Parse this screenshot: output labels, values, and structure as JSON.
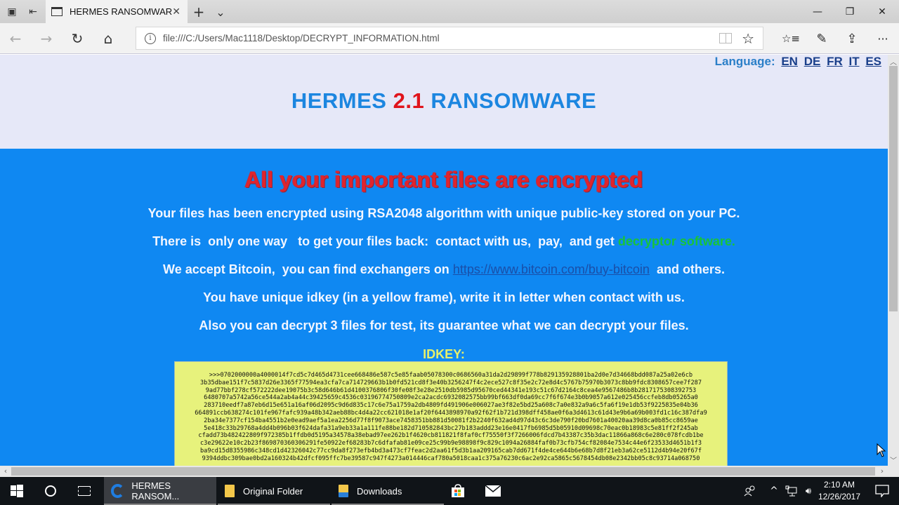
{
  "browser": {
    "tab_title": "HERMES RANSOMWAR",
    "address_url": "file:///C:/Users/Mac1118/Desktop/DECRYPT_INFORMATION.html",
    "icons": {
      "tab_preview": "▣",
      "set_aside": "⇤",
      "new_tab": "+",
      "tab_list": "⌄",
      "back": "←",
      "forward": "→",
      "refresh": "↻",
      "home": "⌂",
      "info": "i",
      "favorite": "☆",
      "favorites_hub": "☆≡",
      "web_note": "✎",
      "share": "⇪",
      "more": "···",
      "minimize": "—",
      "restore": "❐",
      "close": "✕",
      "tab_close": "✕"
    }
  },
  "page": {
    "language_label": "Language:",
    "languages": [
      "EN",
      "DE",
      "FR",
      "IT",
      "ES"
    ],
    "brand": {
      "part1": "HERMES",
      "version": "2.1",
      "part2": "RANSOMWARE"
    },
    "headline": "All your important files are encrypted",
    "messages": {
      "line1": "Your files has been encrypted using RSA2048 algorithm with unique public-key stored on your PC.",
      "line2_text": "There is  only one way   to get your files back:  contact with us,  pay,  and get ",
      "line2_highlight": "decryptor software.",
      "line3_text": "We accept Bitcoin,  you can find exchangers on ",
      "line3_link": "https://www.bitcoin.com/buy-bitcoin",
      "line3_tail": "  and others.",
      "line4": "You have unique idkey (in a yellow frame), write it in letter when contact with us.",
      "line5": "Also you can decrypt 3 files for test, its guarantee what we can decrypt your files."
    },
    "idkey_label": "IDKEY:",
    "idkey_lines": [
      ">>>0702000000a4000014f7cd5c7d465d4731cee668486e587c5e85faab05078300c0686560a31da2d29899f778b829135928801ba2d0e7d34668bdd087a25a02e6cb",
      "3b35dbae151f7c5837d26e3365f77594ea3cfa7ca714729663b1b0fd521cd8f3e40b3256247f4c2ece527c8f35e2c72e8d4c5767b75970b3073c8bb9fdc8308657cee7f287",
      "9ad77bbf278cf572222dee19075b3c58d646b61d4100376806f30fe08f3e28e2510db5985d95670ced44341e193c51c67d2164c8cea4e9567486b8b2817175308392753",
      "6480707a5742a56ce544a2ab4a44c39425659c4536c03196774750809e2ca2acdc6932082575bb99bf663df0da69cc7f6f674e3b0b9057a612e025456ccfeb8db05265a0",
      "283710eedf7a87eb6d15e651a16af06d2095c9d6d835c17c6e75a1759a2db4809fd491906e006027ae3f82e5bd25a608c7a0e832a9a6c5fa6f19e1db53f9225835e04b36",
      "664891ccb638274c101fe967fafc939a48b342aeb88bc4d4a22cc621018e1af20f6443898970a92f62f1b721d398dff458ae0f6a3d4613c61d43e9b6a69b003fd1c16c387dfa9",
      "2ba34e7377cf154ba4551b2e0ead9aef5a1ea2256d77f8f9073ace7458351bb881d50081f2b2240f632ad4d97d43c6c3de790f20bd7601a40020aa39d8ca0b85cc8659ae",
      "5e418c33b29768a4dd4b096b03f624dafa31a9eb33a1a111fe88be182d710582843bc27b183addd23e16e0417fb6985d5b05910d09698c70eac0b18983c5e81ff2f245ab",
      "cfadd73b482422809f972385b1ffdb0d5195a34578a38ebad97ee262b1f4620cb811821f8faf0cf75550f3f7266006fdcd7b43387c35b3dac11866a868c6e280c078fcdb1be",
      "c3e29622e10c2b23f869870360306291fe50922ef68283b7c6dfafab81e09ce25c99b9e98898f9c829c1094a26884faf0b73cfb754cf82084e7534c44e6f23533d4651b1f3",
      "ba9cd15d8355986c348cd1d42326042c77cc9da8f273efb4bd3a473cf7feac2d2aa61f5d3b1aa209165cab7dd671f4de4ce644b6e68b7d8f21eb3a62ce5112d4b94e20f67f",
      "9394ddbc309bae0bd2a160324b42dfcf095ffc7be39587c947f4273a014446caf780a5018caa1c375a76230c6ac2e92ca5865c5678454db08e2342bb05c8c93714a068750"
    ]
  },
  "taskbar": {
    "apps": [
      {
        "label": "HERMES RANSOM...",
        "icon": "edge-icon",
        "active": true
      },
      {
        "label": "Original Folder",
        "icon": "folder-icon",
        "active": false
      },
      {
        "label": "Downloads",
        "icon": "downloads-folder-icon",
        "active": false
      }
    ],
    "clock_time": "2:10 AM",
    "clock_date": "12/26/2017"
  }
}
